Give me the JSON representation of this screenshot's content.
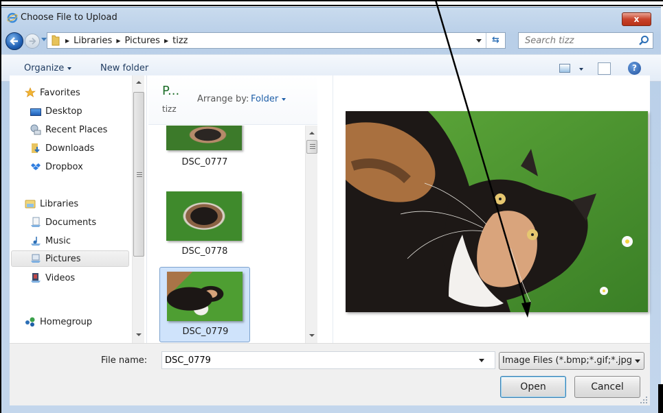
{
  "window": {
    "title": "Choose File to Upload",
    "close_label": "x"
  },
  "navbar": {
    "breadcrumbs": [
      "Libraries",
      "Pictures",
      "tizz"
    ],
    "search_placeholder": "Search tizz",
    "refresh_glyph": "⇆"
  },
  "toolbar": {
    "organize_label": "Organize",
    "new_folder_label": "New folder",
    "help_glyph": "?"
  },
  "sidebar": {
    "items": [
      {
        "label": "Favorites",
        "icon": "star-icon",
        "type": "group"
      },
      {
        "label": "Desktop",
        "icon": "desktop-icon",
        "type": "item"
      },
      {
        "label": "Recent Places",
        "icon": "recent-places-icon",
        "type": "item"
      },
      {
        "label": "Downloads",
        "icon": "downloads-icon",
        "type": "item"
      },
      {
        "label": "Dropbox",
        "icon": "dropbox-icon",
        "type": "item"
      },
      {
        "label": "Libraries",
        "icon": "libraries-icon",
        "type": "group"
      },
      {
        "label": "Documents",
        "icon": "documents-icon",
        "type": "item"
      },
      {
        "label": "Music",
        "icon": "music-icon",
        "type": "item"
      },
      {
        "label": "Pictures",
        "icon": "pictures-icon",
        "type": "item",
        "selected": true
      },
      {
        "label": "Videos",
        "icon": "videos-icon",
        "type": "item"
      },
      {
        "label": "Homegroup",
        "icon": "homegroup-icon",
        "type": "group"
      }
    ]
  },
  "filepane": {
    "library_title": "P...",
    "library_subtitle": "tizz",
    "arrange_label": "Arrange by:",
    "arrange_value": "Folder",
    "files": [
      {
        "name": "DSC_0777",
        "selected": false
      },
      {
        "name": "DSC_0778",
        "selected": false
      },
      {
        "name": "DSC_0779",
        "selected": true
      }
    ]
  },
  "bottom": {
    "file_name_label": "File name:",
    "file_name_value": "DSC_0779",
    "filter_value": "Image Files (*.bmp;*.gif;*.jpg",
    "open_label": "Open",
    "cancel_label": "Cancel"
  },
  "colors": {
    "title_bar": "#c9dbee",
    "close_button": "#c8432b",
    "library_title": "#1e6e2a",
    "link_blue": "#1e5fa8",
    "selection": "#cfe3fb"
  }
}
